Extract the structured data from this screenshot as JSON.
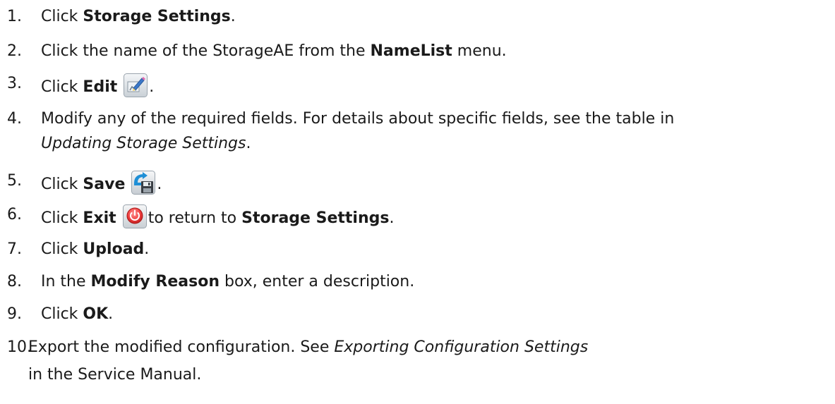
{
  "steps": [
    {
      "number": "1.",
      "parts": [
        "Click ",
        "Storage Settings",
        "."
      ]
    },
    {
      "number": "2.",
      "parts": [
        "Click the name of the StorageAE from the ",
        "NameList",
        " menu."
      ]
    },
    {
      "number": "3.",
      "parts": [
        "Click ",
        "Edit",
        "."
      ],
      "icon": "edit-icon"
    },
    {
      "number": "4.",
      "parts": [
        "Modify any of the required fields. For details about specific fields, see the table in",
        "Updating Storage Settings",
        "."
      ]
    },
    {
      "number": "5.",
      "parts": [
        "Click ",
        "Save",
        "."
      ],
      "icon": "save-icon"
    },
    {
      "number": "6.",
      "parts": [
        "Click ",
        "Exit",
        "to return to ",
        "Storage Settings",
        "."
      ],
      "icon": "exit-icon"
    },
    {
      "number": "7.",
      "parts": [
        "Click ",
        "Upload",
        "."
      ]
    },
    {
      "number": "8.",
      "parts": [
        "In the ",
        "Modify Reason",
        " box, enter a description."
      ]
    },
    {
      "number": "9.",
      "parts": [
        "Click ",
        "OK",
        "."
      ]
    },
    {
      "number": "10.",
      "parts": [
        "Export the modified configuration. See ",
        "Exporting Configuration Settings",
        "in the Service Manual."
      ]
    }
  ]
}
